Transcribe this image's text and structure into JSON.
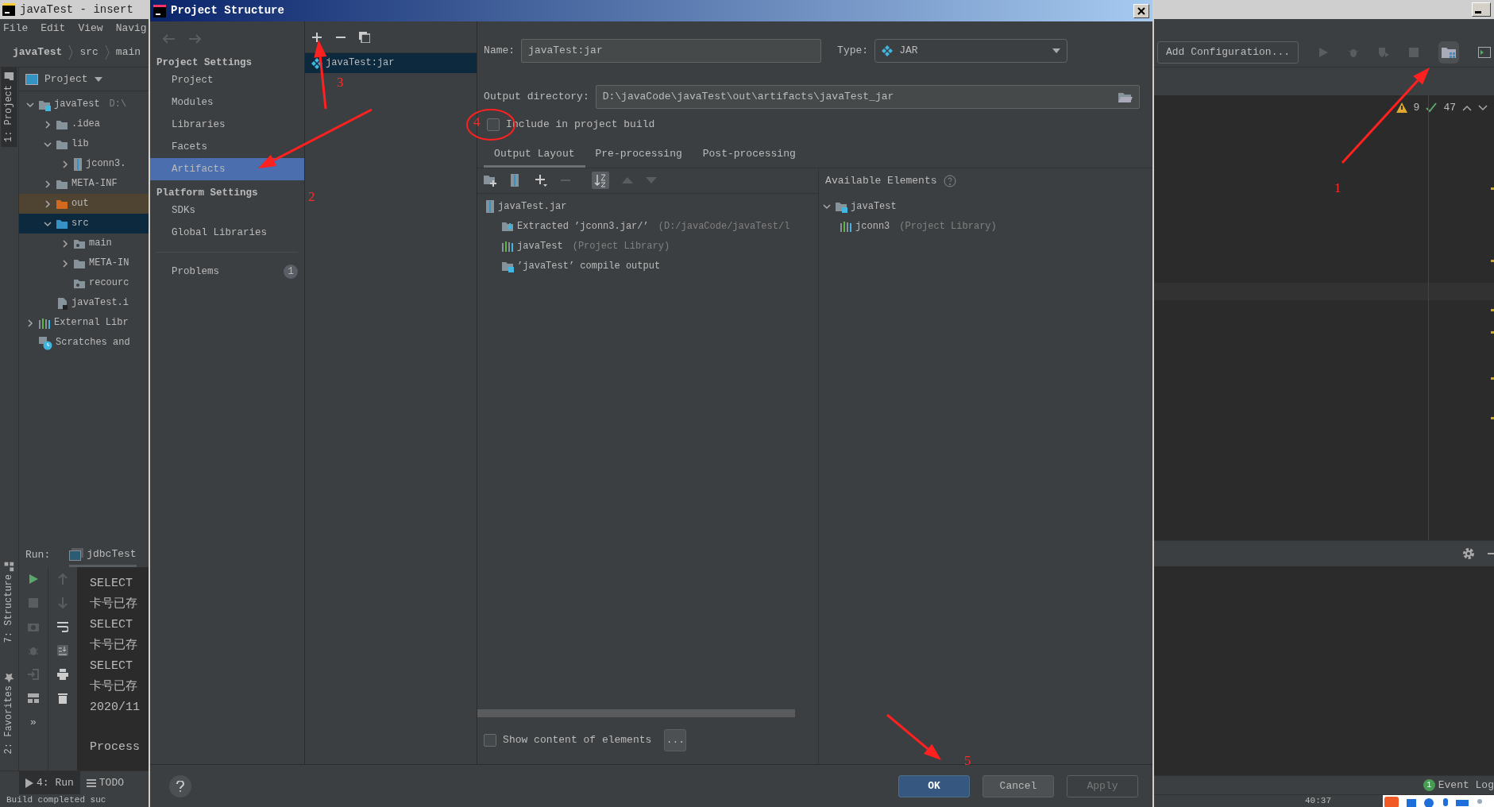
{
  "ide": {
    "title": "javaTest - insert",
    "menu": [
      "File",
      "Edit",
      "View",
      "Navig"
    ],
    "breadcrumb": [
      "javaTest",
      "src",
      "main"
    ],
    "tool_strip": [
      {
        "label": "1: Project",
        "selected": true
      },
      {
        "label": "7: Structure",
        "selected": false
      },
      {
        "label": "2: Favorites",
        "selected": false
      }
    ],
    "project_view": "Project",
    "tree": [
      {
        "label": "javaTest",
        "note": "D:\\",
        "kind": "module",
        "expanded": true,
        "selected": false,
        "children": [
          {
            "label": ".idea",
            "kind": "folder",
            "expanded": false,
            "selected": false
          },
          {
            "label": "lib",
            "kind": "folder",
            "expanded": true,
            "selected": false,
            "children": [
              {
                "label": "jconn3.",
                "kind": "jar",
                "expanded": false,
                "selected": false
              }
            ]
          },
          {
            "label": "META-INF",
            "kind": "folder",
            "expanded": false,
            "selected": false
          },
          {
            "label": "out",
            "kind": "excluded",
            "expanded": false,
            "selected": false
          },
          {
            "label": "src",
            "kind": "source",
            "expanded": true,
            "selected": true,
            "children": [
              {
                "label": "main",
                "kind": "package",
                "expanded": false,
                "selected": false
              },
              {
                "label": "META-IN",
                "kind": "folder",
                "expanded": false,
                "selected": false
              },
              {
                "label": "recourc",
                "kind": "package",
                "selected": false
              }
            ]
          },
          {
            "label": "javaTest.i",
            "kind": "file",
            "selected": false
          }
        ]
      },
      {
        "label": "External Libr",
        "kind": "library",
        "expanded": false,
        "selected": false
      },
      {
        "label": "Scratches and",
        "kind": "scratch",
        "selected": false
      }
    ],
    "run": {
      "label": "Run:",
      "tab": "jdbcTest",
      "lines": [
        "SELECT",
        "卡号已存",
        "SELECT",
        "卡号已存",
        "SELECT",
        "卡号已存",
        "2020/11"
      ],
      "exit_line": "Process",
      "more_tools": "»"
    },
    "bottom_tabs": [
      {
        "label": "4: Run",
        "kind": "run",
        "selected": true
      },
      {
        "label": "TODO",
        "kind": "todo",
        "selected": false
      }
    ],
    "status": "Build completed suc"
  },
  "dialog": {
    "title": "Project Structure",
    "nav": [
      {
        "heading": "Project Settings",
        "items": [
          {
            "label": "Project",
            "selected": false
          },
          {
            "label": "Modules",
            "selected": false
          },
          {
            "label": "Libraries",
            "selected": false
          },
          {
            "label": "Facets",
            "selected": false
          },
          {
            "label": "Artifacts",
            "selected": true
          }
        ]
      },
      {
        "heading": "Platform Settings",
        "items": [
          {
            "label": "SDKs",
            "selected": false
          },
          {
            "label": "Global Libraries",
            "selected": false
          }
        ]
      }
    ],
    "problems": {
      "label": "Problems",
      "count": "1"
    },
    "artifacts": [
      {
        "label": "javaTest:jar",
        "selected": true
      }
    ],
    "name_label": "Name:",
    "name": "javaTest:jar",
    "type_label": "Type:",
    "type": "JAR",
    "output_label": "Output directory:",
    "output_dir": "D:\\javaCode\\javaTest\\out\\artifacts\\javaTest_jar",
    "include_in_build": {
      "label": "Include in project build",
      "checked": false
    },
    "tabs": [
      {
        "label": "Output Layout",
        "selected": true
      },
      {
        "label": "Pre-processing",
        "selected": false
      },
      {
        "label": "Post-processing",
        "selected": false
      }
    ],
    "layout": [
      {
        "label": "javaTest.jar",
        "kind": "jar",
        "children": [
          {
            "label": "Extracted ’jconn3.jar/’",
            "note": "(D:/javaCode/javaTest/l",
            "kind": "extracted"
          },
          {
            "label": "javaTest",
            "note": "(Project Library)",
            "kind": "library"
          },
          {
            "label": "’javaTest’ compile output",
            "kind": "output"
          }
        ]
      }
    ],
    "available_label": "Available Elements",
    "available": [
      {
        "label": "javaTest",
        "kind": "module",
        "expanded": true,
        "children": [
          {
            "label": "jconn3",
            "note": "(Project Library)",
            "kind": "library"
          }
        ]
      }
    ],
    "show_content": {
      "label": "Show content of elements",
      "checked": false
    },
    "more": "...",
    "buttons": [
      {
        "label": "OK",
        "kind": "primary",
        "disabled": false
      },
      {
        "label": "Cancel",
        "kind": "default",
        "disabled": false
      },
      {
        "label": "Apply",
        "kind": "default",
        "disabled": true
      }
    ]
  },
  "ide_right": {
    "run_config": "Add Configuration...",
    "warnings": "9",
    "passed": "47",
    "event_log": {
      "label": "Event Log",
      "count": "1"
    },
    "clock": "40:37"
  },
  "annotations": [
    "1",
    "2",
    "3",
    "4",
    "5"
  ]
}
